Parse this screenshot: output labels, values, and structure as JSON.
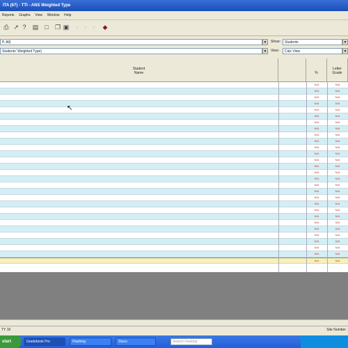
{
  "window": {
    "title": "ITA (67) - TTI - ANS Weighted Type"
  },
  "menu": [
    "Reports",
    "Graphs",
    "View",
    "Window",
    "Help"
  ],
  "toolbar_icons": [
    "printer-icon",
    "arrow-icon",
    "question-icon",
    "chart-icon",
    "document-icon",
    "copy-icon",
    "paste-icon",
    "disabled-icon-1",
    "disabled-icon-2",
    "disabled-icon-3",
    "stamp-icon"
  ],
  "filters": {
    "row1_value": "P, All)",
    "row2_value": "Students' Weighted Type)",
    "show_label": "Show:",
    "show_value": "Students",
    "view_label": "View:",
    "view_value": "Calc View"
  },
  "table": {
    "columns": {
      "name": "Student\nName",
      "score": "%",
      "grade": "Letter\nGrade"
    },
    "cell_value": "N/A",
    "row_count": 29
  },
  "status": {
    "left": "TY 10",
    "right": "Site Number"
  },
  "taskbar": {
    "start": "start",
    "items": [
      "Stu...Ho...",
      "Gradebook Pro",
      "Flashing",
      "Stuco"
    ],
    "search_placeholder": "Search Desktop"
  }
}
